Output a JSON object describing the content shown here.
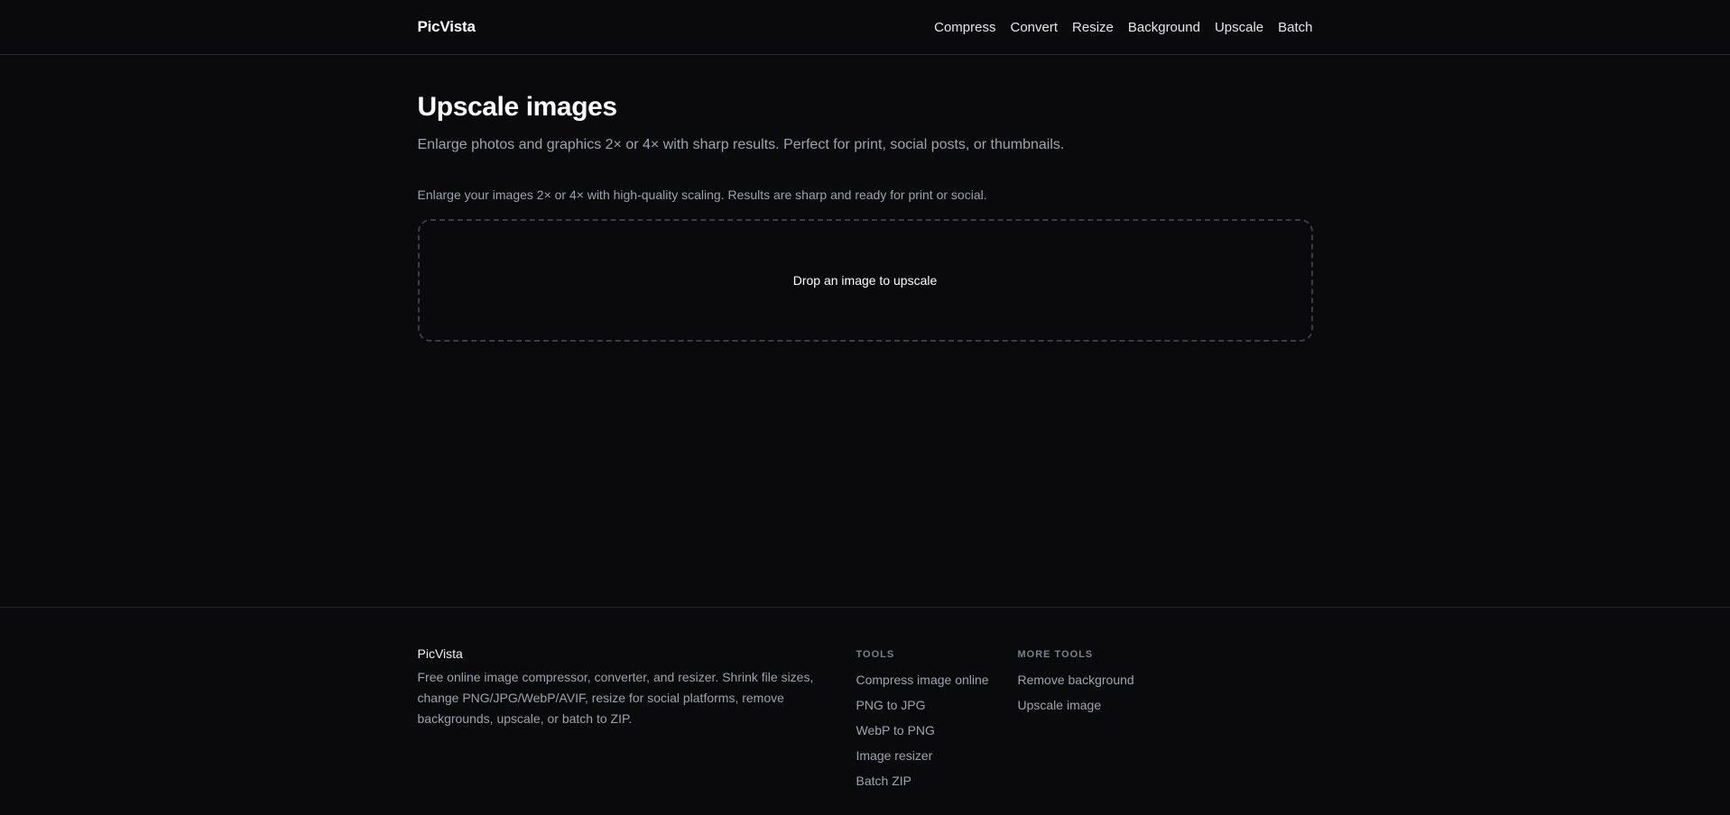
{
  "header": {
    "logo": "PicVista",
    "nav": [
      "Compress",
      "Convert",
      "Resize",
      "Background",
      "Upscale",
      "Batch"
    ]
  },
  "main": {
    "title": "Upscale images",
    "subtitle": "Enlarge photos and graphics 2× or 4× with sharp results. Perfect for print, social posts, or thumbnails.",
    "description": "Enlarge your images 2× or 4× with high-quality scaling. Results are sharp and ready for print or social.",
    "dropzone_label": "Drop an image to upscale"
  },
  "footer": {
    "brand": "PicVista",
    "description": "Free online image compressor, converter, and resizer. Shrink file sizes, change PNG/JPG/WebP/AVIF, resize for social platforms, remove backgrounds, upscale, or batch to ZIP.",
    "tools": {
      "heading": "TOOLS",
      "links": [
        "Compress image online",
        "PNG to JPG",
        "WebP to PNG",
        "Image resizer",
        "Batch ZIP"
      ]
    },
    "more_tools": {
      "heading": "MORE TOOLS",
      "links": [
        "Remove background",
        "Upscale image"
      ]
    }
  },
  "colors": {
    "background": "#0a0a0c",
    "text_primary": "#ffffff",
    "text_muted": "#a0a3ad",
    "border": "#26262b",
    "dropzone_border": "#3c3c42"
  }
}
